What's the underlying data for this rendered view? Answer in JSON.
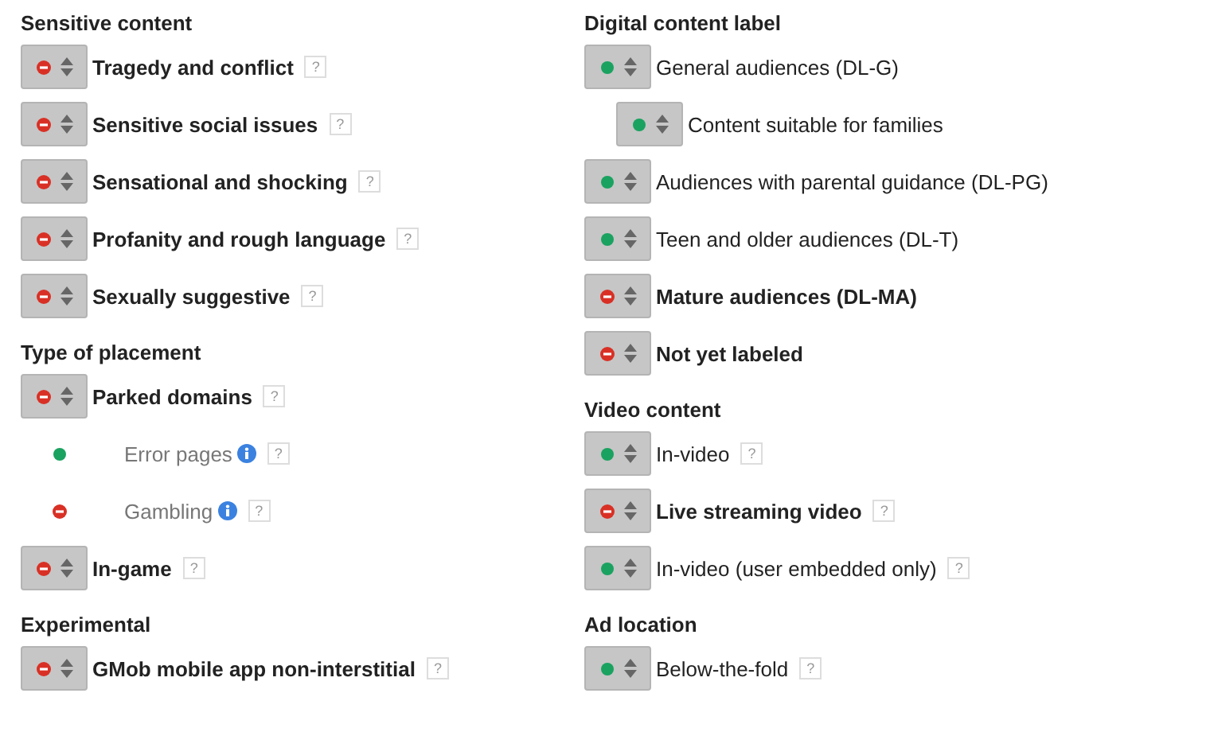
{
  "columns": [
    {
      "sections": [
        {
          "title": "Sensitive content",
          "items": [
            {
              "label": "Tragedy and conflict",
              "kind": "dropdown",
              "excluded": true,
              "help": "?"
            },
            {
              "label": "Sensitive social issues",
              "kind": "dropdown",
              "excluded": true,
              "help": "?"
            },
            {
              "label": "Sensational and shocking",
              "kind": "dropdown",
              "excluded": true,
              "help": "?"
            },
            {
              "label": "Profanity and rough language",
              "kind": "dropdown",
              "excluded": true,
              "help": "?"
            },
            {
              "label": "Sexually suggestive",
              "kind": "dropdown",
              "excluded": true,
              "help": "?"
            }
          ]
        },
        {
          "title": "Type of placement",
          "items": [
            {
              "label": "Parked domains",
              "kind": "dropdown",
              "excluded": true,
              "help": "?",
              "children": [
                {
                  "label": "Error pages",
                  "kind": "plain",
                  "excluded": false,
                  "info": true,
                  "help": "?"
                },
                {
                  "label": "Gambling",
                  "kind": "plain",
                  "excluded": true,
                  "info": true,
                  "help": "?"
                }
              ]
            },
            {
              "label": "In-game",
              "kind": "dropdown",
              "excluded": true,
              "help": "?"
            }
          ]
        },
        {
          "title": "Experimental",
          "items": [
            {
              "label": "GMob mobile app non-interstitial",
              "kind": "dropdown",
              "excluded": true,
              "help": "?"
            }
          ]
        }
      ]
    },
    {
      "sections": [
        {
          "title": "Digital content label",
          "items": [
            {
              "label": "General audiences (DL-G)",
              "kind": "dropdown",
              "excluded": false,
              "children": [
                {
                  "label": "Content suitable for families",
                  "kind": "dropdown",
                  "excluded": false
                }
              ]
            },
            {
              "label": "Audiences with parental guidance (DL-PG)",
              "kind": "dropdown",
              "excluded": false
            },
            {
              "label": "Teen and older audiences (DL-T)",
              "kind": "dropdown",
              "excluded": false
            },
            {
              "label": "Mature audiences (DL-MA)",
              "kind": "dropdown",
              "excluded": true
            },
            {
              "label": "Not yet labeled",
              "kind": "dropdown",
              "excluded": true
            }
          ]
        },
        {
          "title": "Video content",
          "items": [
            {
              "label": "In-video",
              "kind": "dropdown",
              "excluded": false,
              "help": "?"
            },
            {
              "label": "Live streaming video",
              "kind": "dropdown",
              "excluded": true,
              "help": "?"
            },
            {
              "label": "In-video (user embedded only)",
              "kind": "dropdown",
              "excluded": false,
              "help": "?"
            }
          ]
        },
        {
          "title": "Ad location",
          "items": [
            {
              "label": "Below-the-fold",
              "kind": "dropdown",
              "excluded": false,
              "help": "?"
            }
          ]
        }
      ]
    }
  ]
}
